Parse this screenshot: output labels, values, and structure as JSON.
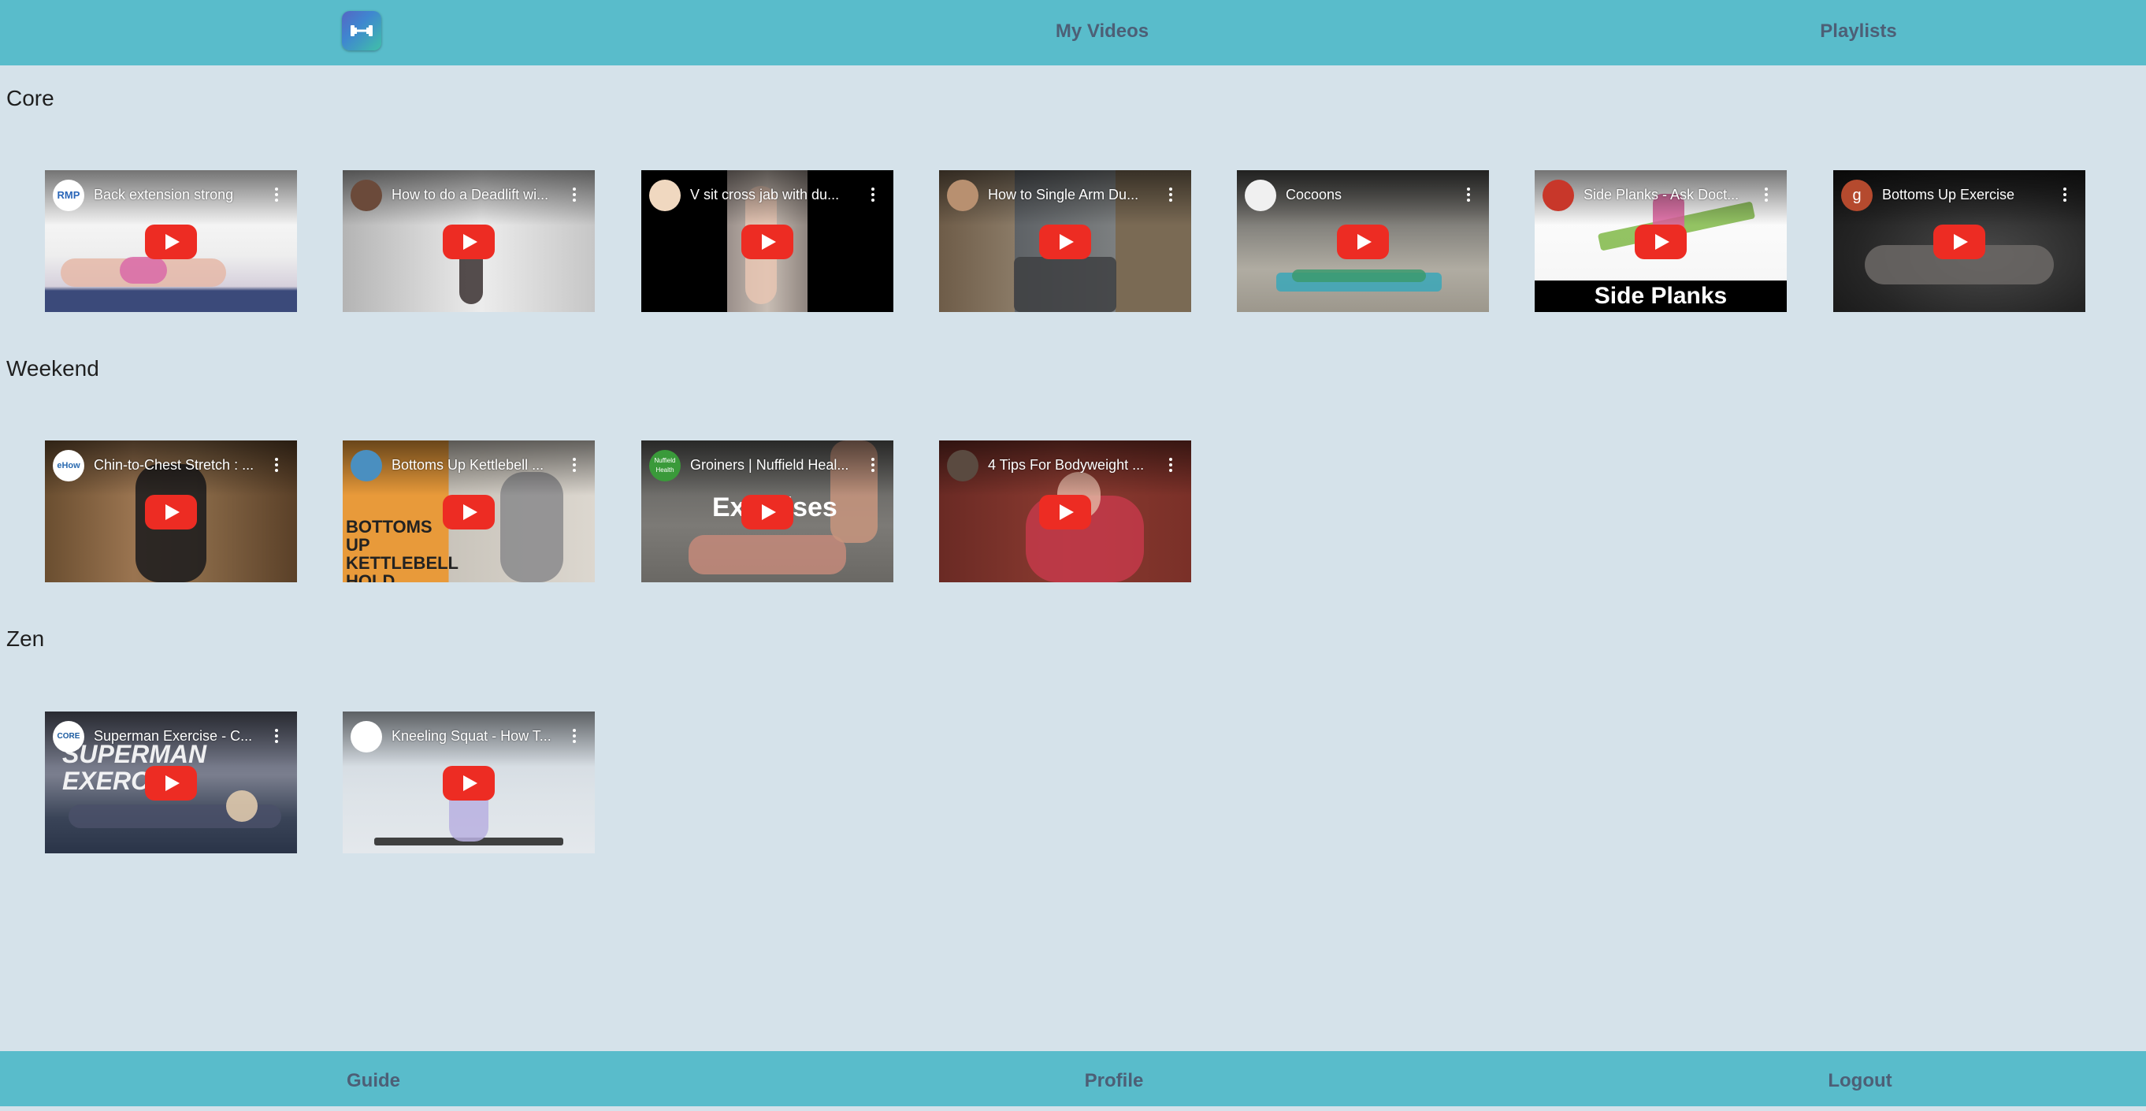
{
  "header": {
    "logo_icon": "dumbbell-icon",
    "my_videos": "My Videos",
    "playlists": "Playlists"
  },
  "footer": {
    "guide": "Guide",
    "profile": "Profile",
    "logout": "Logout"
  },
  "sections": [
    {
      "title": "Core",
      "videos": [
        {
          "title": "Back extension strong",
          "channel_avatar": "RMP"
        },
        {
          "title": "How to do a Deadlift wi...",
          "channel_avatar": ""
        },
        {
          "title": "V sit cross jab with du...",
          "channel_avatar": ""
        },
        {
          "title": "How to Single Arm Du...",
          "channel_avatar": ""
        },
        {
          "title": "Cocoons",
          "channel_avatar": ""
        },
        {
          "title": "Side Planks - Ask Doct...",
          "channel_avatar": "",
          "caption": "Side Planks"
        },
        {
          "title": "Bottoms Up Exercise",
          "channel_avatar": "g"
        }
      ]
    },
    {
      "title": "Weekend",
      "videos": [
        {
          "title": "Chin-to-Chest Stretch : ...",
          "channel_avatar": "eHow"
        },
        {
          "title": "Bottoms Up Kettlebell ...",
          "channel_avatar": "",
          "overlay": "BOTTOMS UP KETTLEBELL HOLD"
        },
        {
          "title": "Groiners | Nuffield Heal...",
          "channel_avatar": "Nuffield Health",
          "overlay": "Exercises"
        },
        {
          "title": "4 Tips For Bodyweight ...",
          "channel_avatar": ""
        }
      ]
    },
    {
      "title": "Zen",
      "videos": [
        {
          "title": "Superman Exercise - C...",
          "channel_avatar": "CORE",
          "overlay": "SUPERMAN EXERCISE"
        },
        {
          "title": "Kneeling Squat - How T...",
          "channel_avatar": ""
        }
      ]
    }
  ]
}
